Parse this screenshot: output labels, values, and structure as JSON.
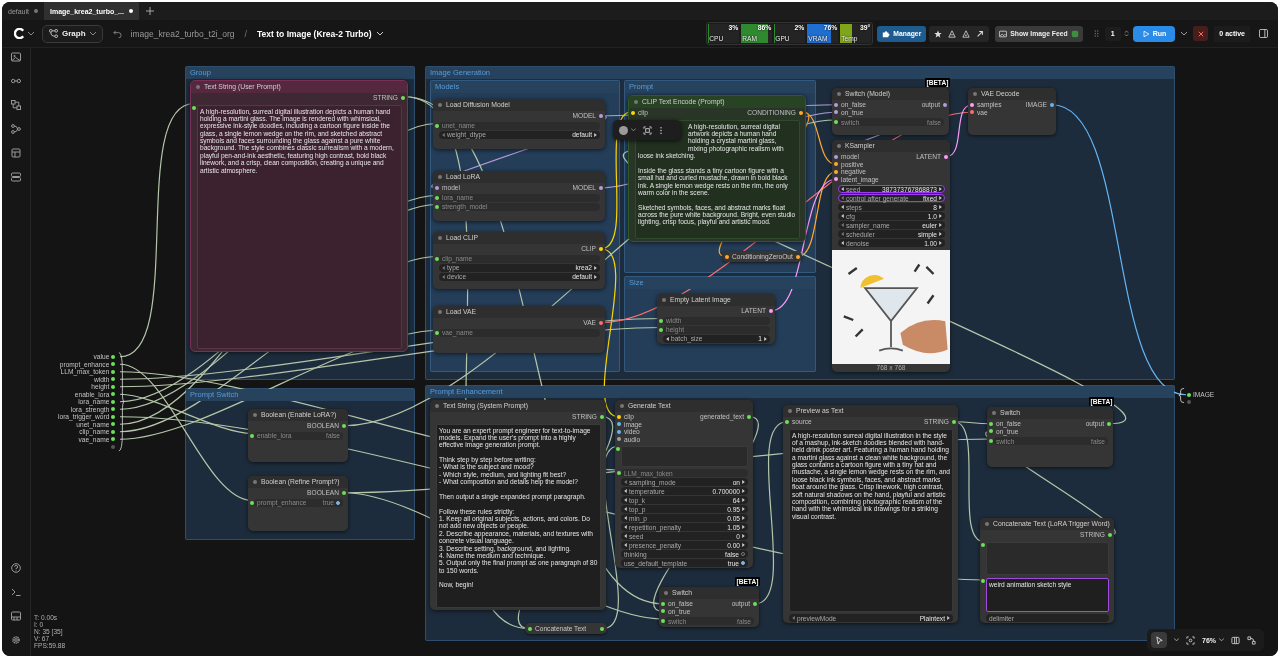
{
  "tabs": [
    {
      "label": "default",
      "selected": false,
      "unsaved": true
    },
    {
      "label": "Image_krea2_turbo_...",
      "selected": true,
      "unsaved": true
    }
  ],
  "toolbar": {
    "graph": "Graph",
    "workflow_path": "image_krea2_turbo_t2i_org",
    "separator": "/",
    "workflow_title": "Text to Image (Krea-2 Turbo)"
  },
  "monitors": [
    {
      "label": "CPU",
      "reading": "3%",
      "level": 0.03,
      "color": "#2f8a2f"
    },
    {
      "label": "RAM",
      "reading": "86%",
      "level": 0.86,
      "color": "#2f8a2f"
    },
    {
      "label": "GPU",
      "reading": "2%",
      "level": 0.02,
      "color": "#2f8a2f"
    },
    {
      "label": "VRAM",
      "reading": "76%",
      "level": 0.76,
      "color": "#1f6fd1"
    },
    {
      "label": "Temp",
      "reading": "39°",
      "level": 0.39,
      "color": "#7fa61a"
    }
  ],
  "actions": {
    "manager": "Manager",
    "image_feed": "Show Image Feed",
    "queue_count": "1",
    "run": "Run",
    "queue_status": "0 active"
  },
  "canvas": {
    "groups": [
      {
        "title": "Group"
      },
      {
        "title": "Image Generation"
      },
      {
        "title": "Models"
      },
      {
        "title": "Prompt"
      },
      {
        "title": "Size"
      },
      {
        "title": "Prompt Switch"
      },
      {
        "title": "Prompt Enhancement"
      }
    ],
    "nodes": [
      {
        "title": "Text String (User Prompt)",
        "color": "#7a2f55",
        "collapsed": false,
        "outputs": [
          {
            "name": "STRING",
            "color": "#6de05a"
          }
        ],
        "widgets": [
          {
            "kind": "textarea",
            "text": "A high-resolution, surreal digital illustration depicts a human hand holding a martini glass. The image is rendered with whimsical, expressive ink-style doodles, including a cartoon figure inside the glass, a single lemon wedge on the rim, and sketched abstract symbols and faces surrounding the glass against a pure white background. The style combines classic surrealism with a modern, playful pen-and-ink aesthetic, featuring high contrast, bold black linework, and a crisp, clean composition, creating a unique and artistic atmosphere.",
            "linked": true,
            "focused": false
          }
        ]
      },
      {
        "title": "Load Diffusion Model",
        "collapsed": false,
        "outputs": [
          {
            "name": "MODEL",
            "color": "#b39ddb"
          }
        ],
        "widgets": [
          {
            "kind": "converted",
            "label": "unet_name"
          },
          {
            "kind": "combo",
            "label": "weight_dtype",
            "value": "default"
          }
        ]
      },
      {
        "title": "Load LoRA",
        "collapsed": false,
        "inputs": [
          {
            "name": "model",
            "color": "#b39ddb"
          }
        ],
        "outputs": [
          {
            "name": "MODEL",
            "color": "#b39ddb"
          }
        ],
        "widgets": [
          {
            "kind": "converted",
            "label": "lora_name"
          },
          {
            "kind": "converted",
            "label": "strength_model"
          }
        ]
      },
      {
        "title": "Load CLIP",
        "collapsed": false,
        "outputs": [
          {
            "name": "CLIP",
            "color": "#ffd500"
          }
        ],
        "widgets": [
          {
            "kind": "converted",
            "label": "clip_name"
          },
          {
            "kind": "combo",
            "label": "type",
            "value": "krea2"
          },
          {
            "kind": "combo",
            "label": "device",
            "value": "default"
          }
        ]
      },
      {
        "title": "Load VAE",
        "collapsed": false,
        "outputs": [
          {
            "name": "VAE",
            "color": "#ff6e6e"
          }
        ],
        "widgets": [
          {
            "kind": "converted",
            "label": "vae_name"
          }
        ]
      },
      {
        "title": "CLIP Text Encode (Prompt)",
        "color": "#2f5a28",
        "collapsed": false,
        "inputs": [
          {
            "name": "clip",
            "color": "#ffd500"
          }
        ],
        "outputs": [
          {
            "name": "CONDITIONING",
            "color": "#ffa931"
          }
        ],
        "widgets": [
          {
            "kind": "textarea",
            "text": "A high-resolution, surreal digital artwork depicts a human hand holding a crystal martini glass, mixing photographic realism with loose ink sketching.\n\nInside the glass stands a tiny cartoon figure with a small hat and curled mustache, drawn in bold black ink. A single lemon wedge rests on the rim, the only warm color in the scene.\n\nSketched symbols, faces, and abstract marks float across the pure white background. Bright, even studio lighting, crisp focus, playful and artistic mood.",
            "focused": false
          }
        ]
      },
      {
        "title": "ConditioningZeroOut",
        "collapsed": true,
        "inputs": [
          {
            "color": "#ffa931"
          }
        ],
        "outputs": [
          {
            "color": "#ffa931"
          }
        ]
      },
      {
        "title": "Empty Latent Image",
        "collapsed": false,
        "outputs": [
          {
            "name": "LATENT",
            "color": "#ff9cf9"
          }
        ],
        "widgets": [
          {
            "kind": "converted",
            "label": "width"
          },
          {
            "kind": "converted",
            "label": "height"
          },
          {
            "kind": "number",
            "label": "batch_size",
            "value": "1"
          }
        ]
      },
      {
        "title": "Switch (Model)",
        "badge": "[BETA]",
        "collapsed": false,
        "inputs": [
          {
            "name": "on_false",
            "color": "#b39ddb"
          },
          {
            "name": "on_true",
            "color": "#b39ddb"
          }
        ],
        "outputs": [
          {
            "name": "output",
            "color": "#b39ddb"
          }
        ],
        "widgets": [
          {
            "kind": "converted",
            "label": "switch",
            "value": "false"
          }
        ]
      },
      {
        "title": "KSampler",
        "collapsed": false,
        "inputs": [
          {
            "name": "model",
            "color": "#b39ddb"
          },
          {
            "name": "positive",
            "color": "#ffa931"
          },
          {
            "name": "negative",
            "color": "#ffa931"
          },
          {
            "name": "latent_image",
            "color": "#ff9cf9"
          }
        ],
        "outputs": [
          {
            "name": "LATENT",
            "color": "#ff9cf9"
          }
        ],
        "widgets": [
          {
            "kind": "number",
            "label": "seed",
            "value": "387373767868873",
            "highlighted": true
          },
          {
            "kind": "combo",
            "label": "control after generate",
            "value": "fixed",
            "highlighted": true
          },
          {
            "kind": "number",
            "label": "steps",
            "value": "8",
            "highlighted": false
          },
          {
            "kind": "number",
            "label": "cfg",
            "value": "1.0",
            "highlighted": false
          },
          {
            "kind": "combo",
            "label": "sampler_name",
            "value": "euler",
            "highlighted": false
          },
          {
            "kind": "combo",
            "label": "scheduler",
            "value": "simple",
            "highlighted": false
          },
          {
            "kind": "number",
            "label": "denoise",
            "value": "1.00",
            "highlighted": false
          }
        ],
        "preview": {
          "caption": "768 x 768"
        }
      },
      {
        "title": "VAE Decode",
        "collapsed": false,
        "inputs": [
          {
            "name": "samples",
            "color": "#ff9cf9"
          },
          {
            "name": "vae",
            "color": "#ff6e6e"
          }
        ],
        "outputs": [
          {
            "name": "IMAGE",
            "color": "#64b5f6"
          }
        ]
      },
      {
        "title": "Boolean (Enable LoRA?)",
        "collapsed": false,
        "outputs": [
          {
            "name": "BOOLEAN",
            "color": "#6de05a"
          }
        ],
        "widgets": [
          {
            "kind": "converted",
            "label": "enable_lora",
            "value": "false"
          }
        ]
      },
      {
        "title": "Boolean (Refine Prompt?)",
        "collapsed": false,
        "outputs": [
          {
            "name": "BOOLEAN",
            "color": "#6de05a"
          }
        ],
        "widgets": [
          {
            "kind": "toggle",
            "label": "prompt_enhance",
            "value": "true",
            "on": true,
            "linked": true
          }
        ]
      },
      {
        "title": "Text String (System Prompt)",
        "collapsed": false,
        "outputs": [
          {
            "name": "STRING",
            "color": "#6de05a"
          }
        ],
        "widgets": [
          {
            "kind": "textarea",
            "text": "You are an expert prompt engineer for text-to-image models. Expand the user's prompt into a highly effective image generation prompt.\n\nThink step by step before writing:\n- What is the subject and mood?\n- Which style, medium, and lighting fit best?\n- What composition and details help the model?\n\nThen output a single expanded prompt paragraph.\n\nFollow these rules strictly:\n1. Keep all original subjects, actions, and colors. Do not add new objects or people.\n2. Describe appearance, materials, and textures with concrete visual language.\n3. Describe setting, background, and lighting.\n4. Name the medium and technique.\n5. Output only the final prompt as one paragraph of 80 to 150 words.\n\nNow, begin!",
            "focused": false
          }
        ]
      },
      {
        "title": "Concatenate Text",
        "collapsed": true,
        "inputs": [
          {
            "color": "#6de05a"
          }
        ],
        "outputs": [
          {
            "color": "#6de05a"
          }
        ]
      },
      {
        "title": "Generate Text",
        "collapsed": false,
        "inputs": [
          {
            "name": "clip",
            "color": "#ffd500"
          },
          {
            "name": "image",
            "color": "#64b5f6"
          },
          {
            "name": "video",
            "color": "#64b5f6"
          },
          {
            "name": "audio",
            "color": "#9e9e9e"
          }
        ],
        "outputs": [
          {
            "name": "generated_text",
            "color": "#6de05a"
          }
        ],
        "widgets": [
          {
            "kind": "textarea",
            "linked": true,
            "focused": false
          },
          {
            "kind": "converted",
            "label": "LLM_max_token"
          },
          {
            "kind": "combo",
            "label": "sampling_mode",
            "value": "on"
          },
          {
            "kind": "number",
            "label": "temperature",
            "value": "0.700000"
          },
          {
            "kind": "number",
            "label": "top_k",
            "value": "64"
          },
          {
            "kind": "number",
            "label": "top_p",
            "value": "0.95"
          },
          {
            "kind": "number",
            "label": "min_p",
            "value": "0.05"
          },
          {
            "kind": "number",
            "label": "repetition_penalty",
            "value": "1.05"
          },
          {
            "kind": "number",
            "label": "seed",
            "value": "0"
          },
          {
            "kind": "number",
            "label": "presence_penalty",
            "value": "0.00"
          },
          {
            "kind": "toggle",
            "label": "thinking",
            "value": "false",
            "on": false,
            "linked": false
          },
          {
            "kind": "toggle",
            "label": "use_default_template",
            "value": "true",
            "on": true,
            "linked": false
          }
        ]
      },
      {
        "title": "Switch",
        "badge": "[BETA]",
        "collapsed": false,
        "inputs": [
          {
            "name": "on_false",
            "color": "#6de05a"
          },
          {
            "name": "on_true",
            "color": "#6de05a"
          }
        ],
        "outputs": [
          {
            "name": "output",
            "color": "#6de05a"
          }
        ],
        "widgets": [
          {
            "kind": "converted",
            "label": "switch",
            "value": "false"
          }
        ]
      },
      {
        "title": "Preview as Text",
        "collapsed": false,
        "inputs": [
          {
            "name": "source",
            "color": "#6de05a"
          }
        ],
        "outputs": [
          {
            "name": "STRING",
            "color": "#6de05a"
          }
        ],
        "widgets": [
          {
            "kind": "textarea",
            "text": "A high-resolution surreal digital illustration in the style of a mashup, ink-sketch doodles blended with hand-held drink poster art. Featuring a human hand holding a martini glass against a clean white background, the glass contains a cartoon figure with a tiny hat and mustache, a single lemon wedge rests on the rim, and loose black ink symbols, faces, and abstract marks float around the glass. Crisp linework, high contrast, soft natural shadows on the hand, playful and artistic composition, combining photographic realism of the hand with the whimsical ink drawings for a striking visual contrast.",
            "focused": false
          },
          {
            "kind": "combo",
            "label": "previewMode",
            "value": "Plaintext"
          }
        ]
      },
      {
        "title": "Switch",
        "badge": "[BETA]",
        "collapsed": false,
        "inputs": [
          {
            "name": "on_false",
            "color": "#6de05a"
          },
          {
            "name": "on_true",
            "color": "#6de05a"
          }
        ],
        "outputs": [
          {
            "name": "output",
            "color": "#6de05a"
          }
        ],
        "widgets": [
          {
            "kind": "converted",
            "label": "switch",
            "value": "false"
          }
        ]
      },
      {
        "title": "Concatenate Text (LoRA Trigger Word)",
        "collapsed": false,
        "outputs": [
          {
            "name": "STRING",
            "color": "#6de05a"
          }
        ],
        "widgets": [
          {
            "kind": "textarea",
            "linked": true,
            "focused": false
          },
          {
            "kind": "textarea",
            "text": "weird animation sketch style",
            "linked": true,
            "focused": true
          },
          {
            "kind": "text",
            "label": "delimiter"
          }
        ]
      }
    ],
    "bundles": [
      {
        "kind": "inputs",
        "labels": [
          "value",
          "prompt_enhance",
          "LLM_max_token",
          "width",
          "height",
          "enable_lora",
          "lora_name",
          "lora_strength",
          "lora_trigger_word",
          "unet_name",
          "clip_name",
          "vae_name"
        ]
      },
      {
        "kind": "outputs",
        "labels": [
          "IMAGE"
        ]
      }
    ],
    "stats": [
      "T: 0.00s",
      "I: 0",
      "N: 35 [35]",
      "V: 67",
      "FPS:59.88"
    ],
    "zoom": "76%"
  }
}
